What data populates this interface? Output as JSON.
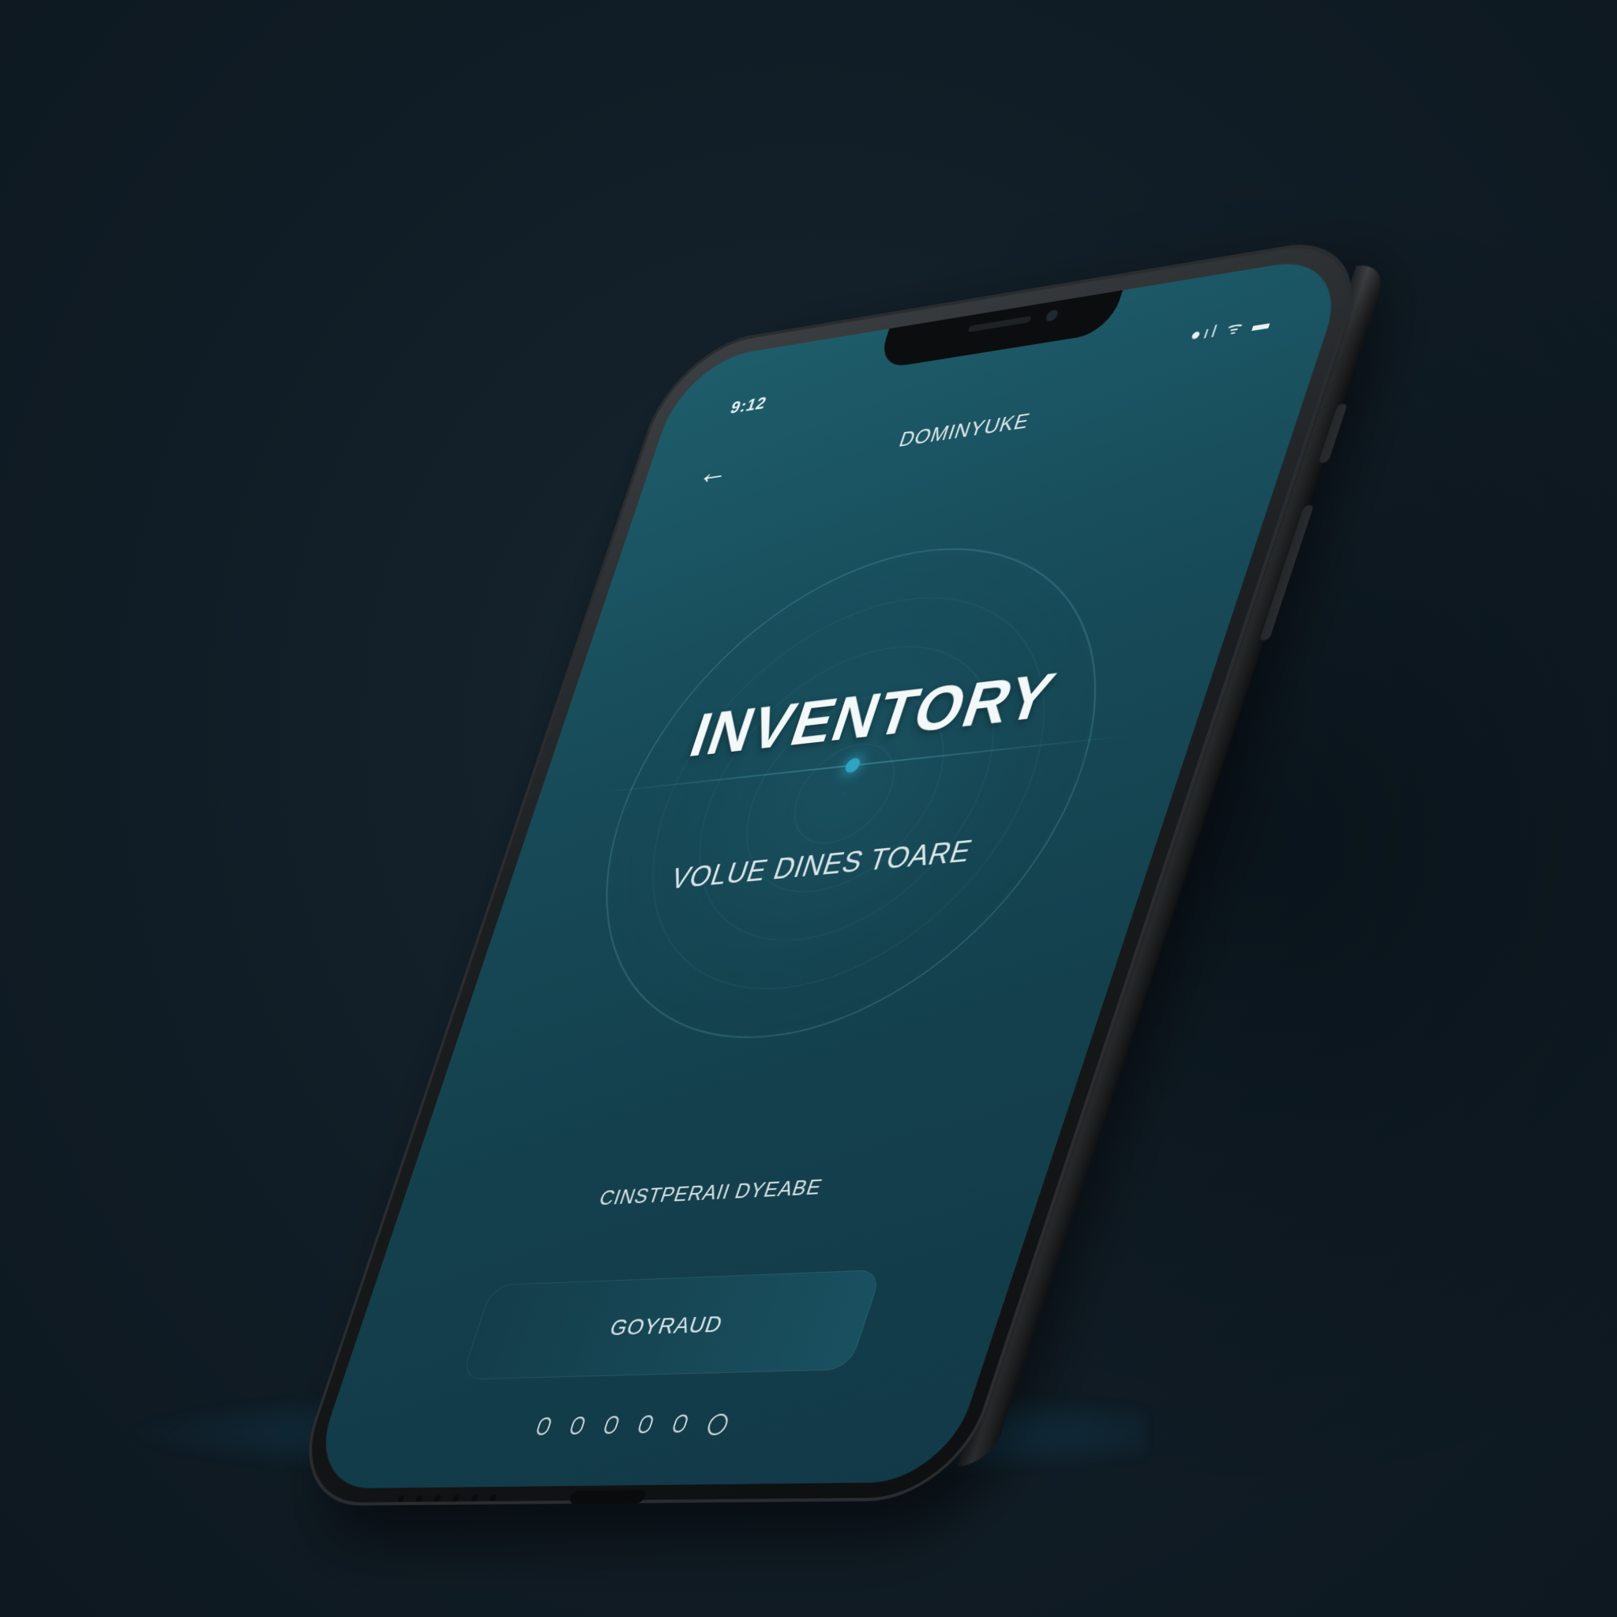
{
  "status_bar": {
    "time": "9:12",
    "icons": "●ıl ᯤ ▬"
  },
  "header": {
    "back_icon": "back-arrow-icon",
    "title": "DOMINYUKE"
  },
  "hero": {
    "title": "INVENTORY",
    "subtitle": "VOLUE DINES TOARE"
  },
  "caption": "CINSTPERAII DYEABE",
  "cta": {
    "label": "GOYRAUD"
  },
  "pager": {
    "count": 6,
    "active_index": 5
  },
  "colors": {
    "screen": "#174a58",
    "accent": "#2fa3c2",
    "background": "#111d26"
  }
}
